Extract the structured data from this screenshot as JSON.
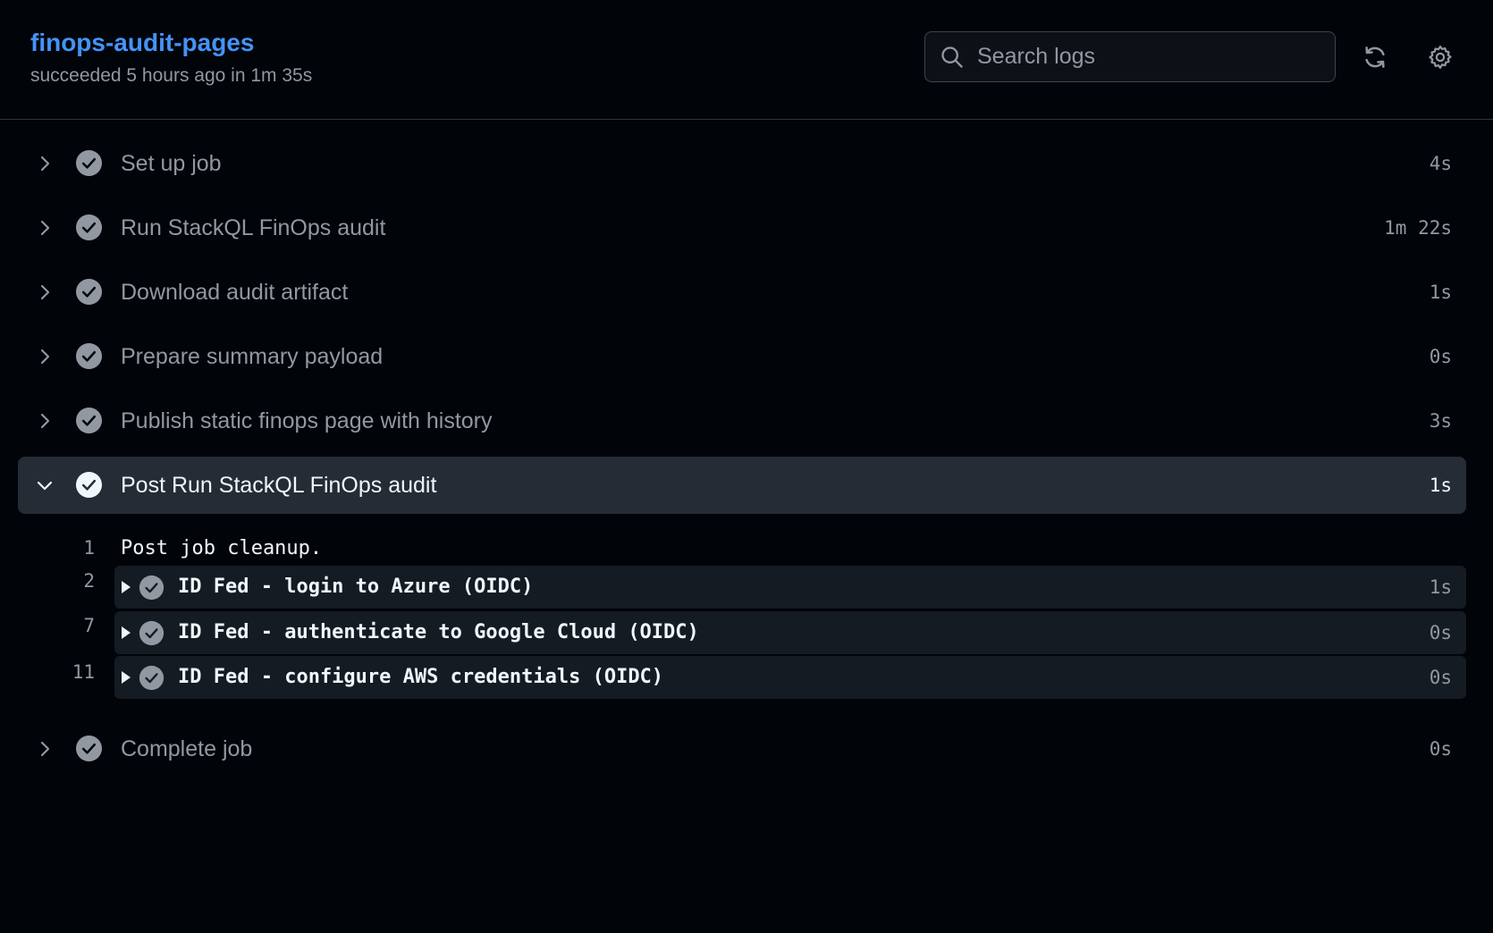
{
  "header": {
    "title": "finops-audit-pages",
    "subtitle": "succeeded 5 hours ago in 1m 35s"
  },
  "search": {
    "placeholder": "Search logs",
    "value": ""
  },
  "toolbar": {
    "refresh_icon": "sync-icon",
    "settings_icon": "gear-icon"
  },
  "steps": [
    {
      "label": "Set up job",
      "duration": "4s",
      "status": "success",
      "expanded": false
    },
    {
      "label": "Run StackQL FinOps audit",
      "duration": "1m 22s",
      "status": "success",
      "expanded": false
    },
    {
      "label": "Download audit artifact",
      "duration": "1s",
      "status": "success",
      "expanded": false
    },
    {
      "label": "Prepare summary payload",
      "duration": "0s",
      "status": "success",
      "expanded": false
    },
    {
      "label": "Publish static finops page with history",
      "duration": "3s",
      "status": "success",
      "expanded": false
    },
    {
      "label": "Post Run StackQL FinOps audit",
      "duration": "1s",
      "status": "success",
      "expanded": true
    },
    {
      "label": "Complete job",
      "duration": "0s",
      "status": "success",
      "expanded": false
    }
  ],
  "log": {
    "line1": {
      "num": "1",
      "text": "Post job cleanup."
    },
    "groups": [
      {
        "num": "2",
        "label": "ID Fed - login to Azure (OIDC)",
        "duration": "1s"
      },
      {
        "num": "7",
        "label": "ID Fed - authenticate to Google Cloud (OIDC)",
        "duration": "0s"
      },
      {
        "num": "11",
        "label": "ID Fed - configure AWS credentials (OIDC)",
        "duration": "0s"
      }
    ]
  },
  "colors": {
    "background": "#010409",
    "accent": "#4493f8",
    "muted": "#9198a1",
    "active_row": "#262c36"
  }
}
